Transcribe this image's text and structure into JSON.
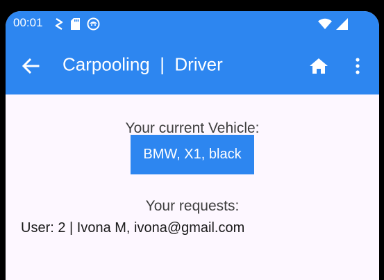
{
  "status_bar": {
    "time": "00:01",
    "left_icons": [
      "usb-debug-icon",
      "sd-card-icon",
      "app-notification-icon"
    ],
    "right_icons": [
      "wifi-icon",
      "cell-signal-icon"
    ]
  },
  "app_bar": {
    "title": "Carpooling  |  Driver",
    "color": "#2d86f0",
    "icons": [
      "arrow-back-icon",
      "home-icon",
      "more-vert-icon"
    ]
  },
  "main": {
    "vehicle_label": "Your current Vehicle:",
    "vehicle_button": "BMW, X1, black",
    "requests_label": "Your requests:",
    "requests": [
      "User: 2 | Ivona M, ivona@gmail.com"
    ]
  }
}
